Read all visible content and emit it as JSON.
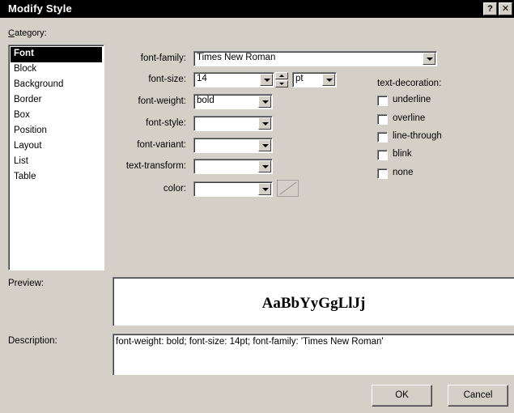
{
  "window": {
    "title": "Modify Style",
    "help_button": "?",
    "close_button": "✕"
  },
  "category": {
    "label_accel": "C",
    "label_rest": "ategory:",
    "items": [
      "Font",
      "Block",
      "Background",
      "Border",
      "Box",
      "Position",
      "Layout",
      "List",
      "Table"
    ],
    "selected": "Font"
  },
  "font": {
    "font_family": {
      "label": "font-family:",
      "value": "Times New Roman"
    },
    "font_size": {
      "label": "font-size:",
      "value": "14",
      "unit": "pt"
    },
    "font_weight": {
      "label": "font-weight:",
      "value": "bold"
    },
    "font_style": {
      "label": "font-style:",
      "value": ""
    },
    "font_variant": {
      "label": "font-variant:",
      "value": ""
    },
    "text_transform": {
      "label": "text-transform:",
      "value": ""
    },
    "color": {
      "label": "color:",
      "value": ""
    }
  },
  "text_decoration": {
    "label": "text-decoration:",
    "options": [
      {
        "label": "underline",
        "checked": false
      },
      {
        "label": "overline",
        "checked": false
      },
      {
        "label": "line-through",
        "checked": false
      },
      {
        "label": "blink",
        "checked": false
      },
      {
        "label": "none",
        "checked": false
      }
    ]
  },
  "preview": {
    "label": "Preview:",
    "sample": "AaBbYyGgLlJj"
  },
  "description": {
    "label": "Description:",
    "text": "font-weight: bold; font-size: 14pt; font-family: 'Times New Roman'"
  },
  "buttons": {
    "ok": "OK",
    "cancel": "Cancel"
  }
}
